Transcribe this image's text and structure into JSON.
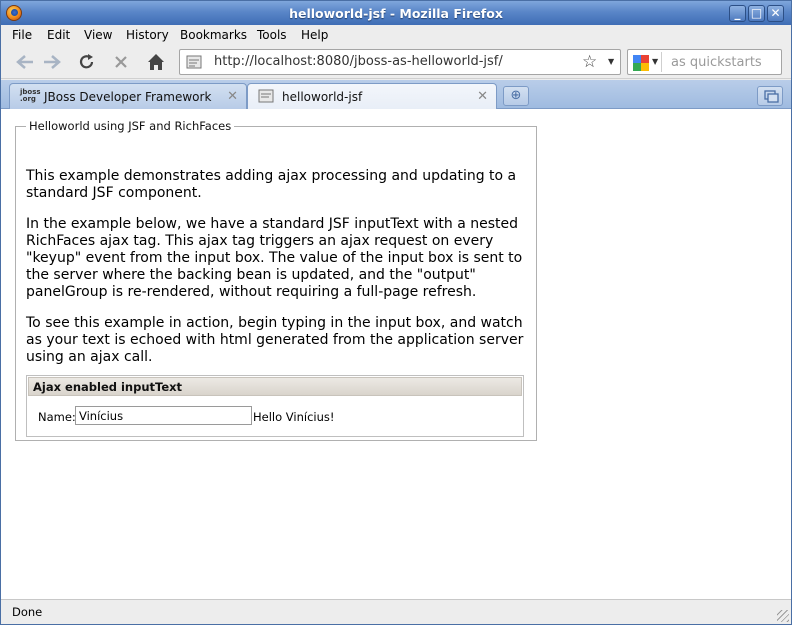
{
  "window": {
    "title": "helloworld-jsf - Mozilla Firefox"
  },
  "menu": [
    {
      "label": "File"
    },
    {
      "label": "Edit"
    },
    {
      "label": "View"
    },
    {
      "label": "History"
    },
    {
      "label": "Bookmarks"
    },
    {
      "label": "Tools"
    },
    {
      "label": "Help"
    }
  ],
  "nav": {
    "url": "http://localhost:8080/jboss-as-helloworld-jsf/",
    "search_placeholder": "as quickstarts"
  },
  "tabs": [
    {
      "label": "JBoss Developer Framework",
      "icon": "jboss-org-icon",
      "icon_text": "jboss .org"
    },
    {
      "label": "helloworld-jsf",
      "icon": "page-icon"
    }
  ],
  "page": {
    "legend": "Helloworld using JSF and RichFaces",
    "paragraphs": [
      "This example demonstrates adding ajax processing and updating to a standard JSF component.",
      "In the example below, we have a standard JSF inputText with a nested RichFaces ajax tag. This ajax tag triggers an ajax request on every \"keyup\" event from the input box. The value of the input box is sent to the server where the backing bean is updated, and the \"output\" panelGroup is re-rendered, without requiring a full-page refresh.",
      "To see this example in action, begin typing in the input box, and watch as your text is echoed with html generated from the application server using an ajax call."
    ],
    "panel": {
      "header": "Ajax enabled inputText",
      "name_label": "Name:",
      "name_value": "Vinícius",
      "output": "Hello Vinícius!"
    }
  },
  "status": {
    "text": "Done"
  }
}
